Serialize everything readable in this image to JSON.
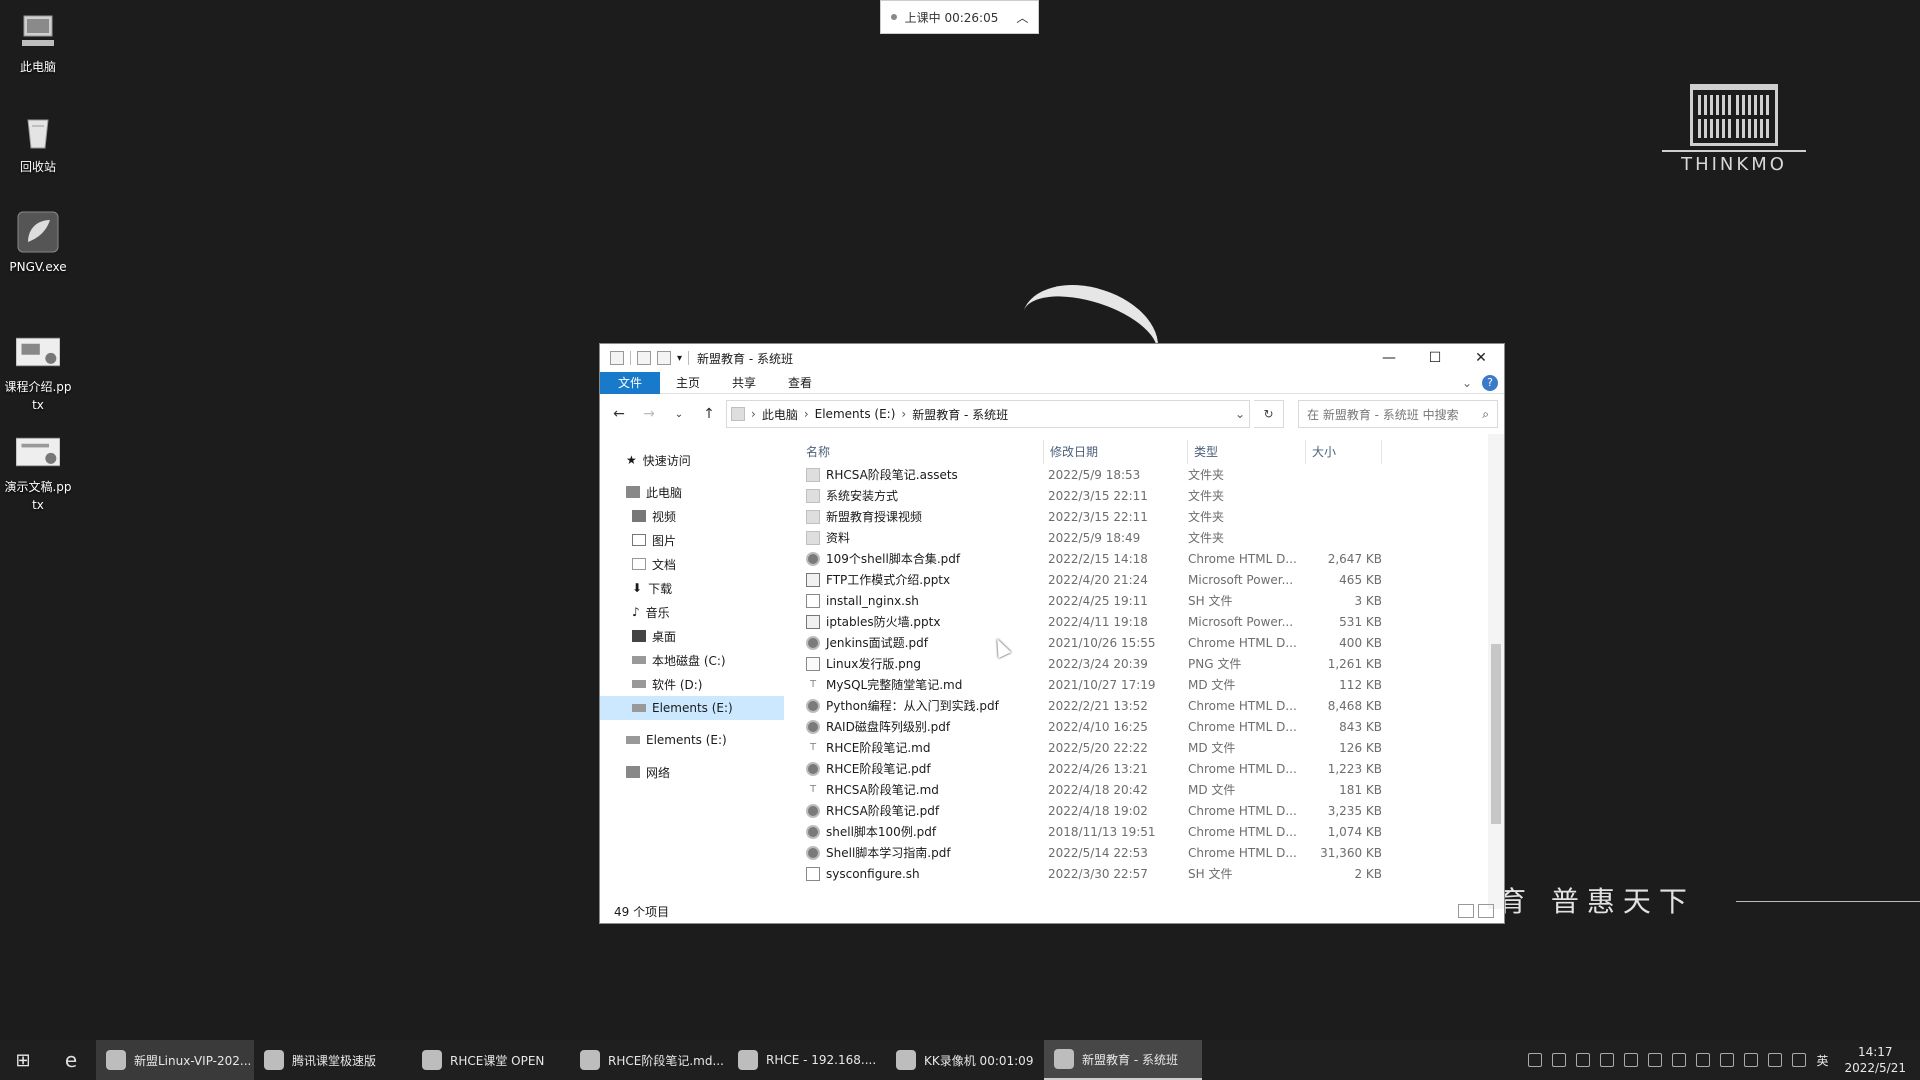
{
  "desktop": {
    "icons": [
      {
        "label": "此电脑",
        "icon": "computer-icon"
      },
      {
        "label": "回收站",
        "icon": "recycle-bin-icon"
      },
      {
        "label": "PNGV.exe",
        "icon": "app-icon"
      },
      {
        "label": "课程介绍.pptx",
        "icon": "pptx-file-icon"
      },
      {
        "label": "演示文稿.pptx",
        "icon": "pptx-file-icon"
      }
    ],
    "timer": {
      "text": "上课中 00:26:05"
    },
    "logo_text": "THINKMO",
    "slogan": "育 普惠天下"
  },
  "window": {
    "title": "新盟教育 - 系统班",
    "ribbon_tabs": [
      "文件",
      "主页",
      "共享",
      "查看"
    ],
    "breadcrumb": [
      "此电脑",
      "Elements (E:)",
      "新盟教育 - 系统班"
    ],
    "search_placeholder": "在 新盟教育 - 系统班 中搜索",
    "nav": [
      {
        "label": "快速访问",
        "level": 1
      },
      {
        "label": "此电脑",
        "level": 1
      },
      {
        "label": "视频",
        "level": 2
      },
      {
        "label": "图片",
        "level": 2
      },
      {
        "label": "文档",
        "level": 2
      },
      {
        "label": "下载",
        "level": 2
      },
      {
        "label": "音乐",
        "level": 2
      },
      {
        "label": "桌面",
        "level": 2
      },
      {
        "label": "本地磁盘 (C:)",
        "level": 2
      },
      {
        "label": "软件 (D:)",
        "level": 2
      },
      {
        "label": "Elements (E:)",
        "level": 2,
        "selected": true
      },
      {
        "label": "Elements (E:)",
        "level": 1
      },
      {
        "label": "网络",
        "level": 1
      }
    ],
    "columns": [
      "名称",
      "修改日期",
      "类型",
      "大小"
    ],
    "files": [
      {
        "name": "RHCSA阶段笔记.assets",
        "date": "2022/5/9 18:53",
        "type": "文件夹",
        "size": "",
        "kind": "folder"
      },
      {
        "name": "系统安装方式",
        "date": "2022/3/15 22:11",
        "type": "文件夹",
        "size": "",
        "kind": "folder"
      },
      {
        "name": "新盟教育授课视频",
        "date": "2022/3/15 22:11",
        "type": "文件夹",
        "size": "",
        "kind": "folder"
      },
      {
        "name": "资料",
        "date": "2022/5/9 18:49",
        "type": "文件夹",
        "size": "",
        "kind": "folder"
      },
      {
        "name": "109个shell脚本合集.pdf",
        "date": "2022/2/15 14:18",
        "type": "Chrome HTML D...",
        "size": "2,647 KB",
        "kind": "pdf"
      },
      {
        "name": "FTP工作模式介绍.pptx",
        "date": "2022/4/20 21:24",
        "type": "Microsoft Power...",
        "size": "465 KB",
        "kind": "ppt"
      },
      {
        "name": "install_nginx.sh",
        "date": "2022/4/25 19:11",
        "type": "SH 文件",
        "size": "3 KB",
        "kind": "sh"
      },
      {
        "name": "iptables防火墙.pptx",
        "date": "2022/4/11 19:18",
        "type": "Microsoft Power...",
        "size": "531 KB",
        "kind": "ppt"
      },
      {
        "name": "Jenkins面试题.pdf",
        "date": "2021/10/26 15:55",
        "type": "Chrome HTML D...",
        "size": "400 KB",
        "kind": "pdf"
      },
      {
        "name": "Linux发行版.png",
        "date": "2022/3/24 20:39",
        "type": "PNG 文件",
        "size": "1,261 KB",
        "kind": "png"
      },
      {
        "name": "MySQL完整随堂笔记.md",
        "date": "2021/10/27 17:19",
        "type": "MD 文件",
        "size": "112 KB",
        "kind": "md"
      },
      {
        "name": "Python编程：从入门到实践.pdf",
        "date": "2022/2/21 13:52",
        "type": "Chrome HTML D...",
        "size": "8,468 KB",
        "kind": "pdf"
      },
      {
        "name": "RAID磁盘阵列级别.pdf",
        "date": "2022/4/10 16:25",
        "type": "Chrome HTML D...",
        "size": "843 KB",
        "kind": "pdf"
      },
      {
        "name": "RHCE阶段笔记.md",
        "date": "2022/5/20 22:22",
        "type": "MD 文件",
        "size": "126 KB",
        "kind": "md"
      },
      {
        "name": "RHCE阶段笔记.pdf",
        "date": "2022/4/26 13:21",
        "type": "Chrome HTML D...",
        "size": "1,223 KB",
        "kind": "pdf"
      },
      {
        "name": "RHCSA阶段笔记.md",
        "date": "2022/4/18 20:42",
        "type": "MD 文件",
        "size": "181 KB",
        "kind": "md"
      },
      {
        "name": "RHCSA阶段笔记.pdf",
        "date": "2022/4/18 19:02",
        "type": "Chrome HTML D...",
        "size": "3,235 KB",
        "kind": "pdf"
      },
      {
        "name": "shell脚本100例.pdf",
        "date": "2018/11/13 19:51",
        "type": "Chrome HTML D...",
        "size": "1,074 KB",
        "kind": "pdf"
      },
      {
        "name": "Shell脚本学习指南.pdf",
        "date": "2022/5/14 22:53",
        "type": "Chrome HTML D...",
        "size": "31,360 KB",
        "kind": "pdf"
      },
      {
        "name": "sysconfigure.sh",
        "date": "2022/3/30 22:57",
        "type": "SH 文件",
        "size": "2 KB",
        "kind": "sh"
      }
    ],
    "status": "49 个项目"
  },
  "taskbar": {
    "apps": [
      {
        "label": "新盟Linux-VIP-202...",
        "active": false,
        "highlight": true
      },
      {
        "label": "腾讯课堂极速版",
        "active": false
      },
      {
        "label": "RHCE课堂 OPEN",
        "active": false
      },
      {
        "label": "RHCE阶段笔记.md...",
        "active": false
      },
      {
        "label": "RHCE - 192.168....",
        "active": false
      },
      {
        "label": "KK录像机 00:01:09",
        "active": false
      },
      {
        "label": "新盟教育 - 系统班",
        "active": true
      }
    ],
    "ime": "英",
    "time": "14:17",
    "date": "2022/5/21"
  }
}
